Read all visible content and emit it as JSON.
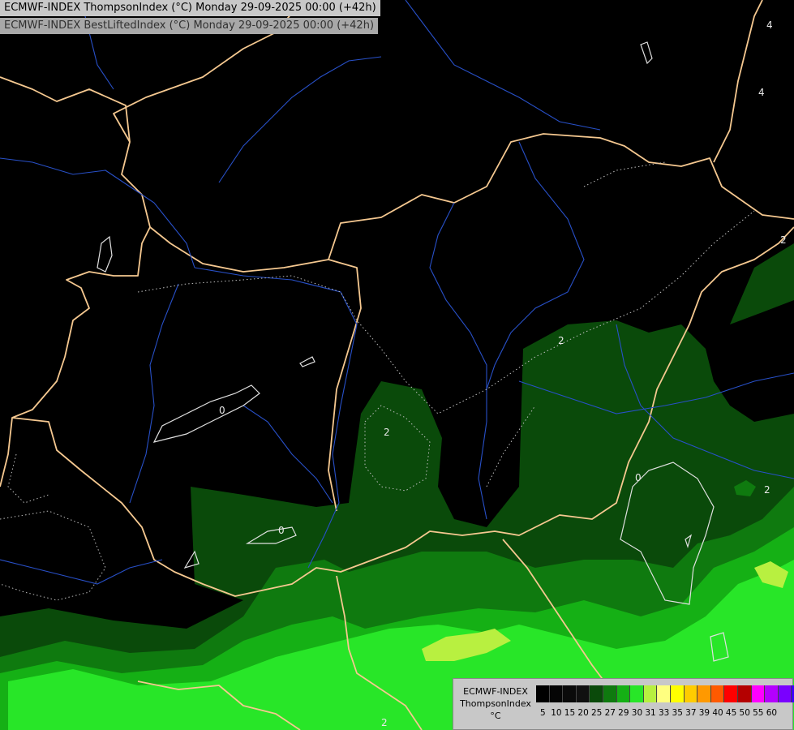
{
  "header": {
    "line1": "ECMWF-INDEX ThompsonIndex (°C) Monday 29-09-2025 00:00 (+42h)",
    "line2": "ECMWF-INDEX BestLiftedIndex (°C) Monday 29-09-2025 00:00 (+42h)"
  },
  "legend": {
    "title_lines": [
      "ECMWF-INDEX",
      "ThompsonIndex",
      "°C"
    ],
    "bins": [
      {
        "label": "5",
        "color": "#000000"
      },
      {
        "label": "10",
        "color": "#050505"
      },
      {
        "label": "15",
        "color": "#0a0a0a"
      },
      {
        "label": "20",
        "color": "#101010"
      },
      {
        "label": "25",
        "color": "#0a4a0a"
      },
      {
        "label": "27",
        "color": "#0f7a0f"
      },
      {
        "label": "29",
        "color": "#15b015"
      },
      {
        "label": "30",
        "color": "#28e628"
      },
      {
        "label": "31",
        "color": "#b8f040"
      },
      {
        "label": "33",
        "color": "#ffff80"
      },
      {
        "label": "35",
        "color": "#ffff00"
      },
      {
        "label": "37",
        "color": "#ffcc00"
      },
      {
        "label": "39",
        "color": "#ff9900"
      },
      {
        "label": "40",
        "color": "#ff5a00"
      },
      {
        "label": "45",
        "color": "#ff0000"
      },
      {
        "label": "50",
        "color": "#b40000"
      },
      {
        "label": "55",
        "color": "#ff00ff"
      },
      {
        "label": "60",
        "color": "#b400ff"
      },
      {
        "label": "",
        "color": "#7a00ff"
      },
      {
        "label": "",
        "color": "#3c00ff"
      },
      {
        "label": "",
        "color": "#0000ff"
      }
    ]
  },
  "contour_labels": [
    "2",
    "2",
    "2",
    "2",
    "0",
    "0",
    "0",
    "2",
    "4",
    "4"
  ],
  "colors": {
    "background": "#000000",
    "ti_25": "#0a4a0a",
    "ti_27": "#0f7a0f",
    "ti_29": "#15b015",
    "ti_30": "#28e628",
    "ti_31": "#b8f040",
    "border": "#f5c890",
    "river": "#2850c8",
    "contour": "#e0e0e0"
  }
}
